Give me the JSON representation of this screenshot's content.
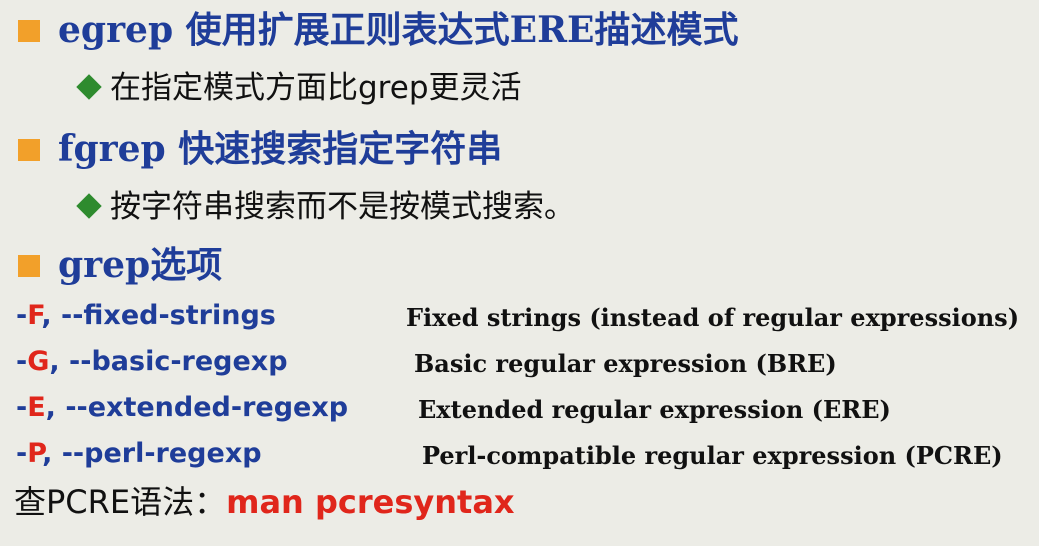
{
  "headings": [
    {
      "prefix": "egrep",
      "text": " 使用扩展正则表达式ERE描述模式"
    },
    {
      "prefix": "fgrep",
      "text": " 快速搜索指定字符串"
    },
    {
      "prefix": "grep",
      "text": "选项"
    }
  ],
  "subs": [
    "在指定模式方面比grep更灵活",
    "按字符串搜索而不是按模式搜索。"
  ],
  "options": [
    {
      "dash": "-",
      "letter": "F",
      "long": ", --fixed-strings",
      "desc": "Fixed strings (instead of regular expressions)"
    },
    {
      "dash": "-",
      "letter": "G",
      "long": ", --basic-regexp",
      "desc": "Basic regular expression (BRE)"
    },
    {
      "dash": "-",
      "letter": "E",
      "long": ", --extended-regexp",
      "desc": "Extended regular expression (ERE)"
    },
    {
      "dash": "-",
      "letter": "P",
      "long": ", --perl-regexp",
      "desc": "Perl-compatible regular expression (PCRE)"
    }
  ],
  "footer": {
    "label": "查PCRE语法：",
    "command": "man pcresyntax"
  },
  "colors": {
    "heading": "#1f3d99",
    "accent": "#e0261b",
    "bullet": "#f2a02a",
    "diamond": "#2e8b2e",
    "background": "#ecece6"
  }
}
